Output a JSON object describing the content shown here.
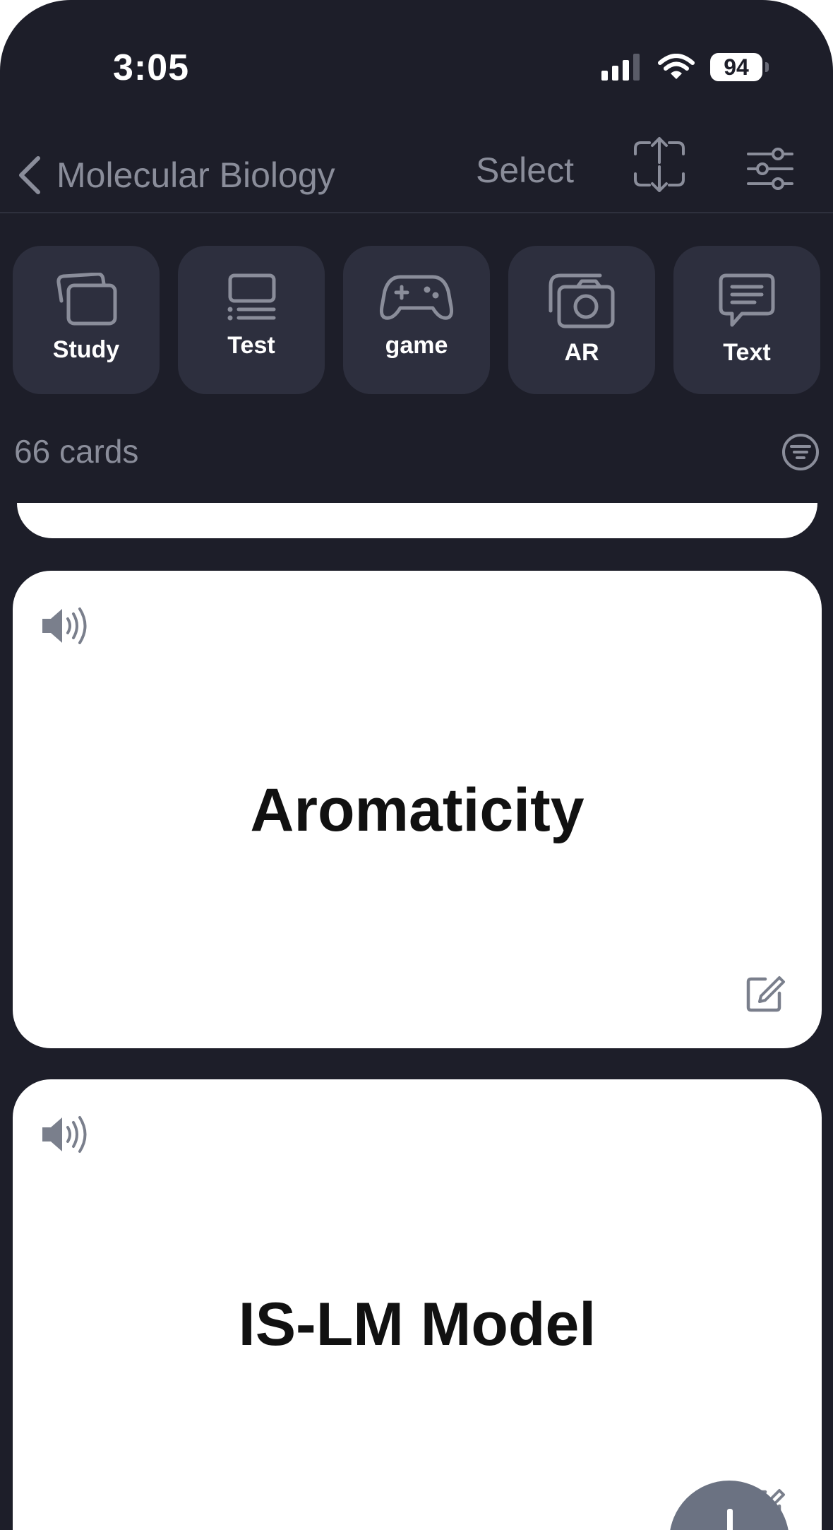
{
  "status_bar": {
    "time": "3:05",
    "battery": "94"
  },
  "nav": {
    "back_label": "Molecular Biology",
    "select_label": "Select"
  },
  "modes": [
    {
      "label": "Study",
      "icon": "cards-icon"
    },
    {
      "label": "Test",
      "icon": "test-list-icon"
    },
    {
      "label": "game",
      "icon": "gamepad-icon"
    },
    {
      "label": "AR",
      "icon": "camera-icon"
    },
    {
      "label": "Text",
      "icon": "chat-bubble-icon"
    }
  ],
  "deck": {
    "card_count": "66 cards"
  },
  "cards": [
    {
      "term": "Aromaticity"
    },
    {
      "term": "IS-LM Model"
    }
  ],
  "colors": {
    "background": "#1d1e29",
    "tile": "#2d2f3e",
    "muted_text": "#8a8d9a",
    "card": "#ffffff",
    "fab": "#6b7282"
  }
}
